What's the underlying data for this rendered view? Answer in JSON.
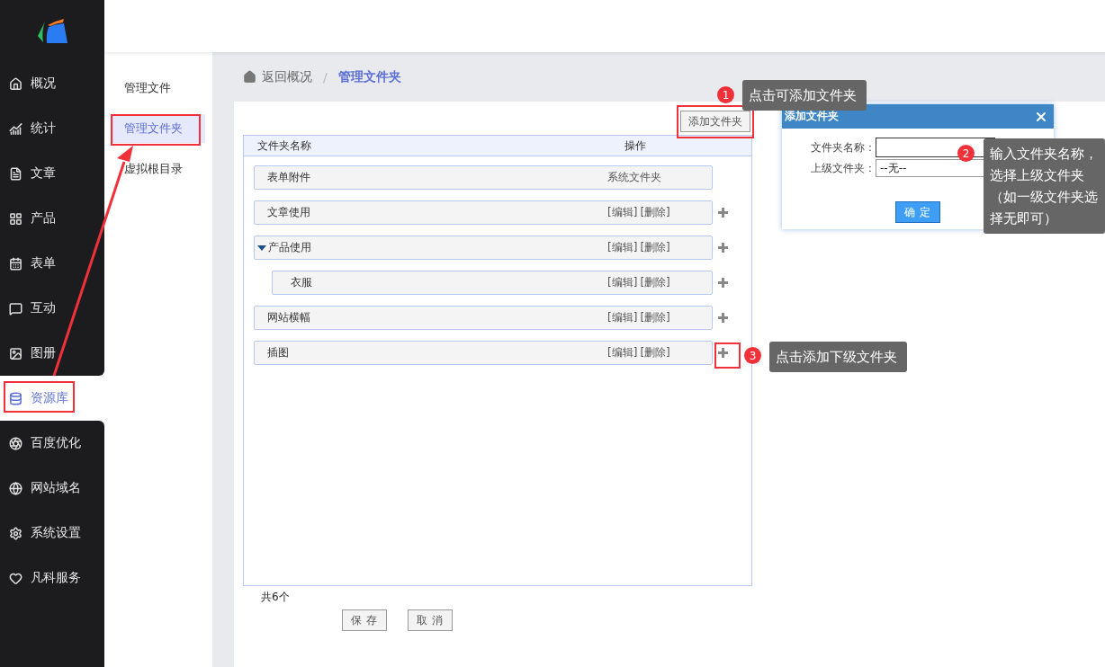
{
  "sidebar": {
    "items": [
      {
        "label": "概况",
        "selected": false
      },
      {
        "label": "统计",
        "selected": false
      },
      {
        "label": "文章",
        "selected": false
      },
      {
        "label": "产品",
        "selected": false
      },
      {
        "label": "表单",
        "selected": false
      },
      {
        "label": "互动",
        "selected": false
      },
      {
        "label": "图册",
        "selected": false
      },
      {
        "label": "资源库",
        "selected": true
      },
      {
        "label": "百度优化",
        "selected": false
      },
      {
        "label": "网站域名",
        "selected": false
      },
      {
        "label": "系统设置",
        "selected": false
      },
      {
        "label": "凡科服务",
        "selected": false
      }
    ]
  },
  "submenu": {
    "items": [
      {
        "label": "管理文件",
        "selected": false
      },
      {
        "label": "管理文件夹",
        "selected": true
      },
      {
        "label": "虚拟根目录",
        "selected": false
      }
    ]
  },
  "breadcrumb": {
    "home": "返回概况",
    "separator": "/",
    "current": "管理文件夹"
  },
  "toolbar": {
    "add_button": "添加文件夹"
  },
  "table": {
    "columns": [
      "文件夹名称",
      "操作"
    ],
    "rows": [
      {
        "kind": "system",
        "name": "表单附件",
        "note": "系统文件夹"
      },
      {
        "kind": "folder",
        "name": "文章使用",
        "actions": [
          "[编辑]",
          "[删除]"
        ]
      },
      {
        "kind": "folder",
        "name": "产品使用",
        "expanded": true,
        "actions": [
          "[编辑]",
          "[删除]"
        ],
        "children": [
          {
            "kind": "folder",
            "name": "衣服",
            "actions": [
              "[编辑]",
              "[删除]"
            ]
          }
        ]
      },
      {
        "kind": "folder",
        "name": "网站横幅",
        "actions": [
          "[编辑]",
          "[删除]"
        ]
      },
      {
        "kind": "folder",
        "name": "插图",
        "actions": [
          "[编辑]",
          "[删除]"
        ]
      }
    ]
  },
  "footer": {
    "count": "共6个",
    "buttons": [
      "保 存",
      "取 消"
    ]
  },
  "dialog": {
    "title": "添加文件夹",
    "fields": [
      {
        "kind": "text",
        "label": "文件夹名称："
      },
      {
        "kind": "select",
        "label": "上级文件夹：",
        "value": "--无--"
      }
    ],
    "confirm": "确 定"
  },
  "annotations": [
    {
      "number": "1",
      "text": "点击可添加文件夹"
    },
    {
      "number": "2",
      "text": "输入文件夹名称，选择上级文件夹（如一级文件夹选择无即可）"
    },
    {
      "number": "3",
      "text": "点击添加下级文件夹"
    }
  ]
}
